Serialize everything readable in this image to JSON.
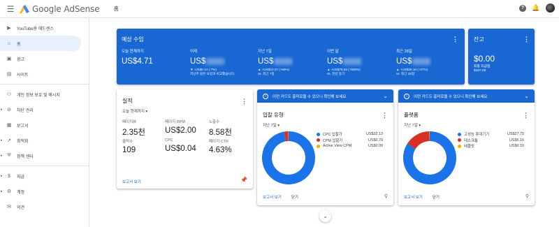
{
  "header": {
    "app_name": "Google AdSense",
    "breadcrumb": "홈",
    "icons": [
      "menu-icon",
      "help-icon",
      "notifications-icon",
      "avatar"
    ]
  },
  "sidebar": {
    "items": [
      {
        "icon": "youtube-icon",
        "label": "YouTube용 애드센스"
      },
      {
        "icon": "home-icon",
        "label": "홈",
        "active": true
      },
      {
        "icon": "ads-icon",
        "label": "광고"
      },
      {
        "icon": "sites-icon",
        "label": "사이트"
      },
      {
        "icon": "privacy-icon",
        "label": "개인 정보 보호 및 메시지"
      },
      {
        "icon": "block-icon",
        "label": "차단 관리"
      },
      {
        "icon": "reports-icon",
        "label": "보고서"
      },
      {
        "icon": "optimization-icon",
        "label": "최적화"
      },
      {
        "icon": "policy-icon",
        "label": "정책 센터"
      },
      {
        "icon": "payments-icon",
        "label": "지급"
      },
      {
        "icon": "account-icon",
        "label": "계정"
      },
      {
        "icon": "feedback-icon",
        "label": "의견"
      }
    ]
  },
  "estimated": {
    "title": "예상 수입",
    "columns": [
      {
        "label": "오늘 현재까지",
        "value": "US$4.71",
        "sub1": "",
        "sub2": ""
      },
      {
        "label": "어제",
        "value": "US$",
        "sub1": "▼ -US$0.14 (-7%)",
        "sub2": "지난주 같은 요일과 비교했습니다."
      },
      {
        "label": "지난 7일",
        "value": "US$",
        "sub1": "▲ +US$12.27 (+59%)",
        "sub2": "vs. 최근 7일"
      },
      {
        "label": "이번 달",
        "value": "US$",
        "sub1": "▲ +US$75.93 (+500%)",
        "sub2": "vs. 전년 동기"
      },
      {
        "label": "최근 28일",
        "value": "US$",
        "sub1": "▲ +US$26.18 (+37%)",
        "sub2": "vs. 최근 28일"
      }
    ]
  },
  "balance": {
    "title": "잔고",
    "amount": "$0.00",
    "sub1": "최종 지급일",
    "sub2": "$157.05"
  },
  "performance": {
    "title": "실적",
    "range": "오늘 현재까지",
    "metrics": [
      {
        "label": "페이지뷰",
        "value": "2.35천"
      },
      {
        "label": "페이지 RPM",
        "value": "US$2.00"
      },
      {
        "label": "노출수",
        "value": "8.58천"
      },
      {
        "label": "클릭수",
        "value": "109"
      },
      {
        "label": "CPC",
        "value": "US$0.04"
      },
      {
        "label": "페이지 CTR",
        "value": "4.63%"
      }
    ],
    "report_link": "보고서 보기"
  },
  "notice_text": "이런 카드도 흥미로울 수 있으니 확인해 보세요.",
  "ad_types": {
    "title": "입찰 유형",
    "range": "지난 7일",
    "report_link": "보고서 보기",
    "close_label": "닫기"
  },
  "platforms": {
    "title": "플랫폼",
    "range": "지난 7일",
    "report_link": "보고서 보기",
    "close_label": "닫기"
  },
  "chart_data": [
    {
      "type": "pie",
      "title": "입찰 유형",
      "categories": [
        "CPC 입찰가",
        "CPM 입찰가",
        "Active View CPM"
      ],
      "values": [
        32.13,
        0.79,
        0.09
      ],
      "labels": [
        "US$32.13",
        "US$0.79",
        "US$0.09"
      ],
      "colors": [
        "#1a73e8",
        "#d93025",
        "#f9ab00"
      ],
      "legend": "right"
    },
    {
      "type": "pie",
      "title": "플랫폼",
      "categories": [
        "고성능 휴대기기",
        "데스크톱",
        "태블릿"
      ],
      "values": [
        27.75,
        5.16,
        0.1
      ],
      "labels": [
        "US$27.75",
        "US$5.16",
        "US$0.10"
      ],
      "colors": [
        "#1a73e8",
        "#d93025",
        "#f9ab00"
      ],
      "legend": "right"
    }
  ]
}
